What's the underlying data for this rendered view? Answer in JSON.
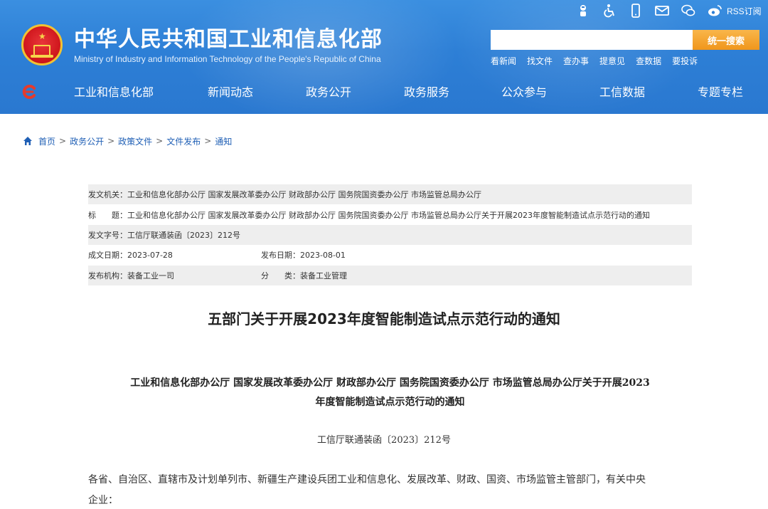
{
  "header": {
    "site_title": "中华人民共和国工业和信息化部",
    "site_subtitle": "Ministry of Industry and Information Technology of the People's Republic of China",
    "rss_label": "RSS订阅",
    "top_icons": [
      "robot-icon",
      "accessibility-icon",
      "mobile-icon",
      "mail-icon",
      "wechat-icon",
      "weibo-icon"
    ],
    "colors": {
      "header_blue": "#2d7fd6",
      "search_button": "#f0961c",
      "link_blue": "#1f5fb5"
    }
  },
  "search": {
    "placeholder": "",
    "button_label": "统一搜索",
    "quick_links": [
      "看新闻",
      "找文件",
      "查办事",
      "提意见",
      "查数据",
      "要投诉"
    ]
  },
  "nav": {
    "items": [
      "工业和信息化部",
      "新闻动态",
      "政务公开",
      "政务服务",
      "公众参与",
      "工信数据",
      "专题专栏"
    ]
  },
  "breadcrumb": [
    "首页",
    "政务公开",
    "政策文件",
    "文件发布",
    "通知"
  ],
  "meta": {
    "issuer_label": "发文机关：",
    "issuer_value": "工业和信息化部办公厅 国家发展改革委办公厅 财政部办公厅 国务院国资委办公厅 市场监管总局办公厅",
    "title_label": "标　　题：",
    "title_value": "工业和信息化部办公厅 国家发展改革委办公厅 财政部办公厅 国务院国资委办公厅 市场监管总局办公厅关于开展2023年度智能制造试点示范行动的通知",
    "docno_label": "发文字号：",
    "docno_value": "工信厅联通装函〔2023〕212号",
    "created_label": "成文日期：",
    "created_value": "2023-07-28",
    "published_label": "发布日期：",
    "published_value": "2023-08-01",
    "org_label": "发布机构：",
    "org_value": "装备工业一司",
    "category_label": "分　　类：",
    "category_value": "装备工业管理"
  },
  "article": {
    "title": "五部门关于开展2023年度智能制造试点示范行动的通知",
    "heading_line1": "工业和信息化部办公厅 国家发展改革委办公厅 财政部办公厅 国务院国资委办公厅 市场监管总局办公厅关于开展2023",
    "heading_line2": "年度智能制造试点示范行动的通知",
    "doc_number": "工信厅联通装函〔2023〕212号",
    "body_line1": "各省、自治区、直辖市及计划单列市、新疆生产建设兵团工业和信息化、发展改革、财政、国资、市场监管主管部门，有关中央",
    "body_line2": "企业："
  }
}
